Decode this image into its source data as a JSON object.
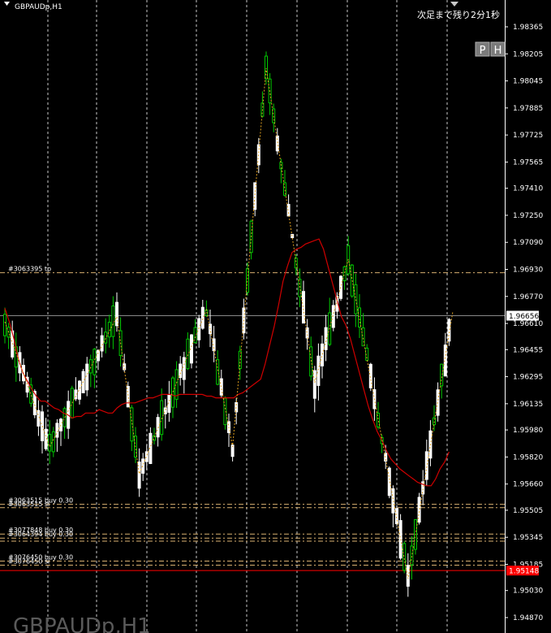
{
  "header": {
    "symbol_label": "GBPAUDp,H1",
    "timer_text": "次足まで残り2分1秒",
    "btn_p": "P",
    "btn_h": "H"
  },
  "watermark": "GBPAUDp,H1",
  "colors": {
    "background": "#000000",
    "bull": "#00c800",
    "bear": "#ffffff",
    "ma": "#d00000",
    "zigzag": "#e0a020",
    "grid": "#c8c8c8",
    "order_line": "#d8b070",
    "bid_line": "#888888",
    "red_line": "#ff0000"
  },
  "chart_data": {
    "type": "candlestick",
    "symbol": "GBPAUDp",
    "timeframe": "H1",
    "ylim": [
      1.9484,
      1.9843
    ],
    "yticks": [
      "1.98365",
      "1.98205",
      "1.98045",
      "1.97885",
      "1.97725",
      "1.97565",
      "1.97410",
      "1.97250",
      "1.97090",
      "1.96930",
      "1.96770",
      "1.96610",
      "1.96455",
      "1.96295",
      "1.96135",
      "1.95980",
      "1.95820",
      "1.95660",
      "1.95505",
      "1.95345",
      "1.95185",
      "1.95030",
      "1.94870"
    ],
    "current_price": "1.96656",
    "current_price_value": 1.96656,
    "red_line_price": "1.95148",
    "red_line_value": 1.95148,
    "candle_count": 120,
    "ma_series": [
      1.967,
      1.9662,
      1.9652,
      1.964,
      1.9632,
      1.9627,
      1.9622,
      1.9618,
      1.9615,
      1.9615,
      1.9613,
      1.9611,
      1.961,
      1.9608,
      1.9607,
      1.9605,
      1.9606,
      1.9606,
      1.9608,
      1.9608,
      1.9608,
      1.961,
      1.9609,
      1.9608,
      1.9608,
      1.9611,
      1.9613,
      1.9614,
      1.9614,
      1.9614,
      1.9615,
      1.9616,
      1.9617,
      1.9617,
      1.9618,
      1.9619,
      1.9619,
      1.9619,
      1.9618,
      1.9619,
      1.9619,
      1.9619,
      1.9619,
      1.9619,
      1.9619,
      1.9618,
      1.9618,
      1.9617,
      1.9617,
      1.9617,
      1.9617,
      1.9617,
      1.9619,
      1.962,
      1.9622,
      1.9624,
      1.9626,
      1.9628,
      1.9637,
      1.9648,
      1.9659,
      1.9672,
      1.9686,
      1.9695,
      1.9703,
      1.9705,
      1.9706,
      1.9708,
      1.9709,
      1.971,
      1.9711,
      1.9705,
      1.9695,
      1.9685,
      1.9675,
      1.9665,
      1.966,
      1.9652,
      1.9642,
      1.9632,
      1.9622,
      1.9612,
      1.9604,
      1.9597,
      1.9592,
      1.9586,
      1.9581,
      1.9578,
      1.9575,
      1.9573,
      1.9571,
      1.9569,
      1.9567,
      1.9566,
      1.9565,
      1.9565,
      1.9569,
      1.9575,
      1.9579,
      1.9585
    ],
    "zigzag_points": [
      [
        0,
        1.9662
      ],
      [
        12,
        1.9588
      ],
      [
        30,
        1.9665
      ],
      [
        36,
        1.9572
      ],
      [
        54,
        1.9669
      ],
      [
        61,
        1.9588
      ],
      [
        70,
        1.9812
      ],
      [
        83,
        1.9626
      ],
      [
        92,
        1.9699
      ],
      [
        108,
        1.951
      ],
      [
        120,
        1.9668
      ]
    ],
    "order_lines": [
      {
        "label": "#3063395 tp",
        "price": 1.9691
      },
      {
        "label": "#3063515 buy 0.30",
        "price": 1.9554
      },
      {
        "label": "#3063515 sl",
        "price": 1.9552
      },
      {
        "label": "#3077848 buy 0.30",
        "price": 1.95364
      },
      {
        "label": "#3064394 buy 0.30",
        "price": 1.9534
      },
      {
        "label": "",
        "price": 1.95322
      },
      {
        "label": "#3076450 buy 0.30",
        "price": 1.95204
      },
      {
        "label": "#3076450 sl",
        "price": 1.9518
      }
    ]
  }
}
